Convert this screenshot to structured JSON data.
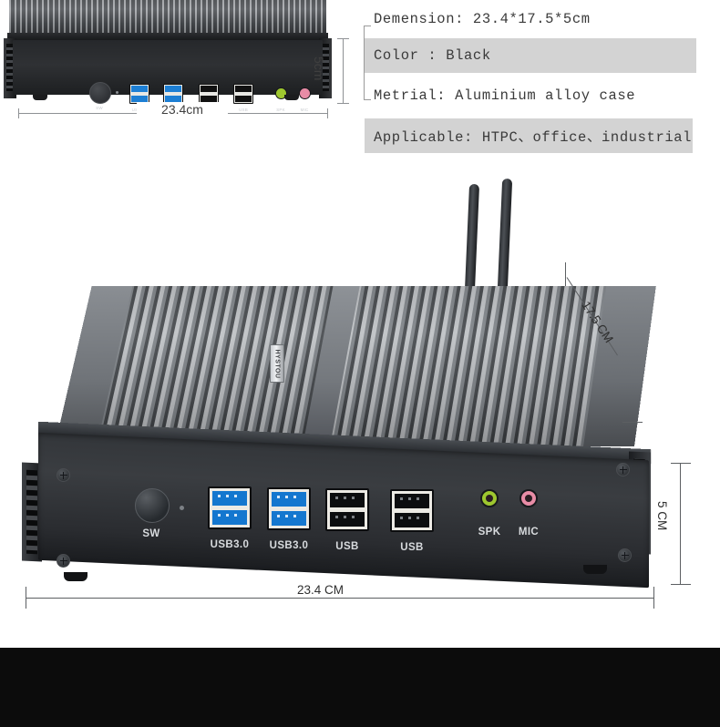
{
  "specs": {
    "rows": [
      {
        "text": "Demension: 23.4*17.5*5cm",
        "highlight": false
      },
      {
        "text": "Color : Black",
        "highlight": true
      },
      {
        "text": "Metrial: Aluminium alloy case",
        "highlight": false
      },
      {
        "text": "Applicable: HTPC、office、industrial",
        "highlight": true
      }
    ]
  },
  "inset": {
    "width_label": "23.4cm",
    "height_label": "5cm",
    "ports": [
      {
        "label": "USB3.0"
      },
      {
        "label": "USB3.0"
      },
      {
        "label": "USB"
      },
      {
        "label": "USB"
      }
    ],
    "power_label": "SW",
    "audio": [
      {
        "label": "SPK"
      },
      {
        "label": "MIC"
      }
    ]
  },
  "product": {
    "brand": "HYSTOU",
    "power_label": "SW",
    "ports": [
      {
        "label": "USB3.0",
        "type": "usb3"
      },
      {
        "label": "USB3.0",
        "type": "usb3"
      },
      {
        "label": "USB",
        "type": "usb2"
      },
      {
        "label": "USB",
        "type": "usb2"
      }
    ],
    "audio": [
      {
        "label": "SPK",
        "color": "#9ec72f"
      },
      {
        "label": "MIC",
        "color": "#e88ca6"
      }
    ],
    "dimensions": {
      "width": "23.4 CM",
      "depth": "17.5 CM",
      "height": "5 CM"
    }
  },
  "colors": {
    "highlight_band": "#d3d3d3",
    "text": "#3a3a3a",
    "usb3_blue": "#1477cf",
    "spk_green": "#9ec72f",
    "mic_pink": "#e88ca6",
    "black_band": "#0c0c0c"
  }
}
